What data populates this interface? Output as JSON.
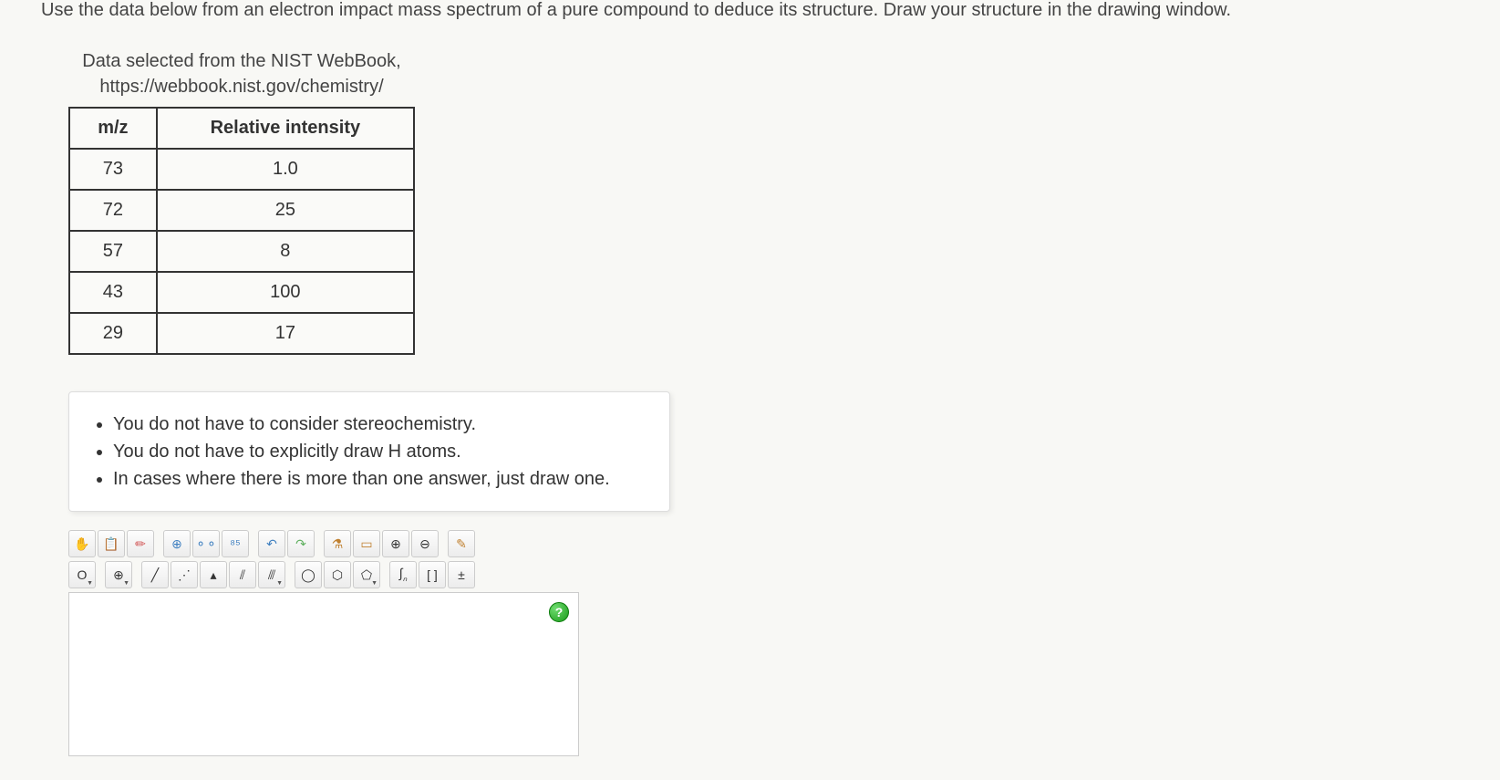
{
  "question": "Use the data below from an electron impact mass spectrum of a pure compound to deduce its structure. Draw your structure in the drawing window.",
  "table": {
    "caption_line1": "Data selected from the NIST WebBook,",
    "caption_line2": "https://webbook.nist.gov/chemistry/",
    "headers": {
      "col1": "m/z",
      "col2": "Relative intensity"
    },
    "rows": [
      {
        "mz": "73",
        "ri": "1.0"
      },
      {
        "mz": "72",
        "ri": "25"
      },
      {
        "mz": "57",
        "ri": "8"
      },
      {
        "mz": "43",
        "ri": "100"
      },
      {
        "mz": "29",
        "ri": "17"
      }
    ]
  },
  "instructions": {
    "i1": "You do not have to consider stereochemistry.",
    "i2": "You do not have to explicitly draw H atoms.",
    "i3": "In cases where there is more than one answer, just draw one."
  },
  "toolbar": {
    "hand": "✋",
    "paste": "📋",
    "erase": "✏",
    "target": "⊕",
    "atoms": "⚬⚬",
    "group": "⁸⁵",
    "undo": "↶",
    "redo": "↷",
    "chemdraw": "⚗",
    "marquee": "▭",
    "zoomin": "⊕",
    "zoomout": "⊖",
    "clean": "✎",
    "element_o": "O",
    "charge": "⊕",
    "single": "╱",
    "dotted": "⋰",
    "wedge": "▴",
    "dblwedge": "⫽",
    "tplwedge": "⫻",
    "ring1": "◯",
    "ring2": "⬡",
    "ring3": "⬠",
    "sn": "ₙ",
    "bracket": "[ ]",
    "pm": "±",
    "help": "?"
  },
  "chart_data": {
    "type": "table",
    "title": "Electron impact mass spectrum data",
    "columns": [
      "m/z",
      "Relative intensity"
    ],
    "rows": [
      [
        73,
        1.0
      ],
      [
        72,
        25
      ],
      [
        57,
        8
      ],
      [
        43,
        100
      ],
      [
        29,
        17
      ]
    ]
  }
}
